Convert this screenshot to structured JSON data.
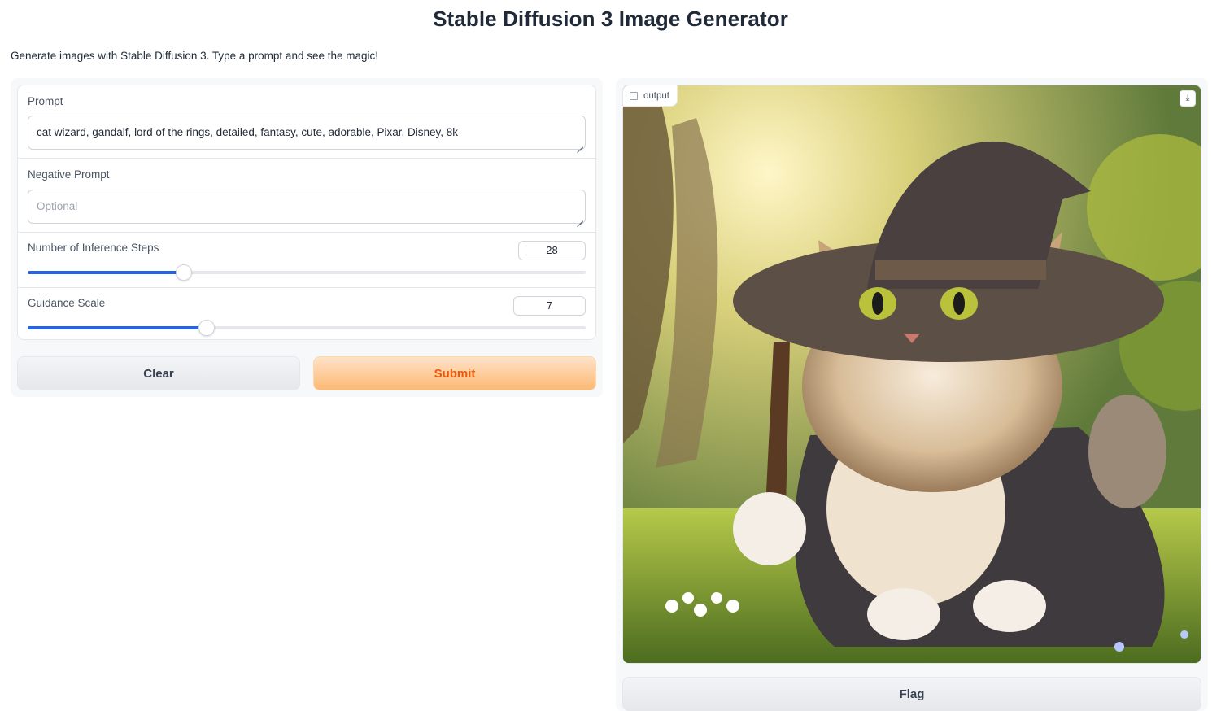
{
  "app": {
    "title": "Stable Diffusion 3 Image Generator",
    "description": "Generate images with Stable Diffusion 3. Type a prompt and see the magic!"
  },
  "form": {
    "prompt": {
      "label": "Prompt",
      "value": "cat wizard, gandalf, lord of the rings, detailed, fantasy, cute, adorable, Pixar, Disney, 8k"
    },
    "negative_prompt": {
      "label": "Negative Prompt",
      "placeholder": "Optional",
      "value": ""
    },
    "steps": {
      "label": "Number of Inference Steps",
      "value": "28",
      "fraction": 0.28
    },
    "guidance": {
      "label": "Guidance Scale",
      "value": "7",
      "fraction": 0.32
    }
  },
  "buttons": {
    "clear": "Clear",
    "submit": "Submit",
    "flag": "Flag"
  },
  "output": {
    "label": "output",
    "image_subject": "cat wizard wearing brown hat and cloak holding a wand in a sunny forest",
    "download_icon": "download-icon"
  },
  "colors": {
    "accent_blue": "#2563eb",
    "submit_text": "#ea580c",
    "submit_bg": "#fdba74"
  }
}
